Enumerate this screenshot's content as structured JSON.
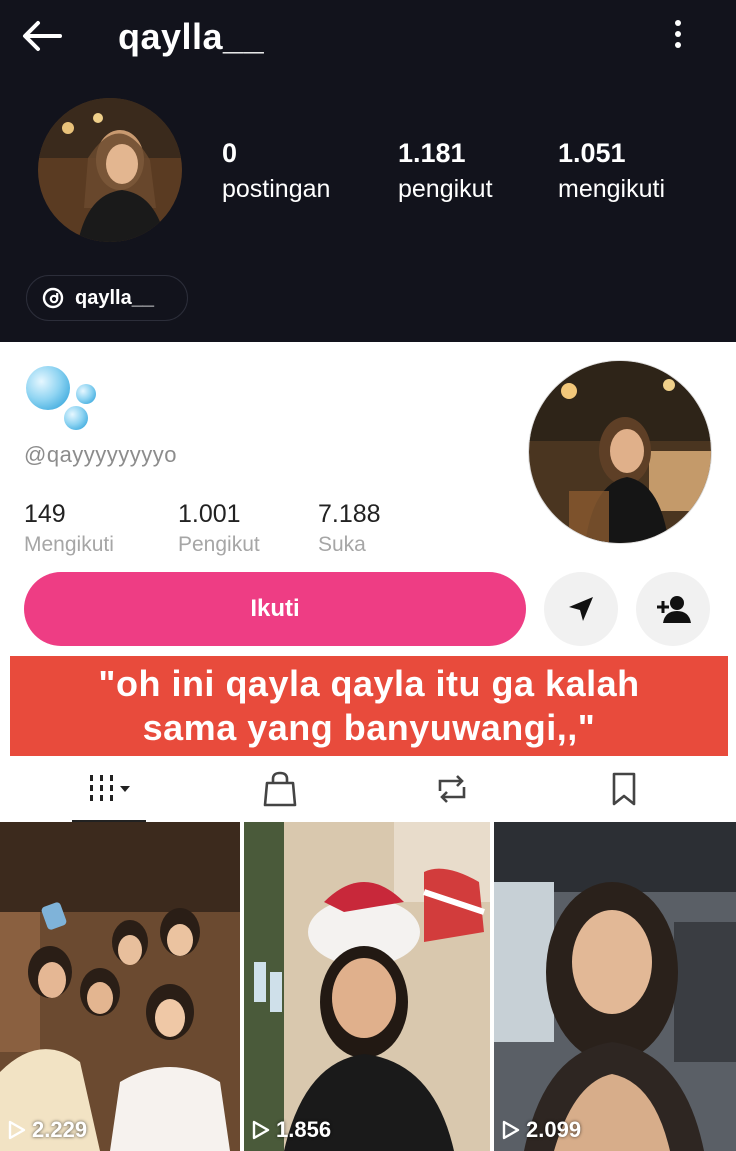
{
  "instagram": {
    "username": "qaylla__",
    "stats": [
      {
        "value": "0",
        "label": "postingan"
      },
      {
        "value": "1.181",
        "label": "pengikut"
      },
      {
        "value": "1.051",
        "label": "mengikuti"
      }
    ],
    "threads_handle": "qaylla__",
    "icons": {
      "back": "arrow-left-icon",
      "menu": "more-vertical-icon",
      "threads": "threads-logo-icon"
    }
  },
  "tiktok": {
    "handle": "@qayyyyyyyyo",
    "stats": [
      {
        "value": "149",
        "label": "Mengikuti"
      },
      {
        "value": "1.001",
        "label": "Pengikut"
      },
      {
        "value": "7.188",
        "label": "Suka"
      }
    ],
    "follow_label": "Ikuti",
    "accent": "#ee3d84",
    "icons": {
      "send": "send-icon",
      "add_friend": "add-user-icon",
      "bubbles": "bubbles-icon"
    },
    "tabs": [
      {
        "name": "videos",
        "icon": "grid-icon"
      },
      {
        "name": "shop",
        "icon": "shopping-bag-icon"
      },
      {
        "name": "reposts",
        "icon": "repost-icon"
      },
      {
        "name": "saved",
        "icon": "bookmark-icon"
      }
    ],
    "videos": [
      {
        "views": "2.229"
      },
      {
        "views": "1.856"
      },
      {
        "views": "2.099"
      }
    ]
  },
  "caption": {
    "line1": "\"oh ini qayla qayla itu ga kalah",
    "line2": "sama yang banyuwangi,,\"",
    "background": "#e84b3c"
  }
}
